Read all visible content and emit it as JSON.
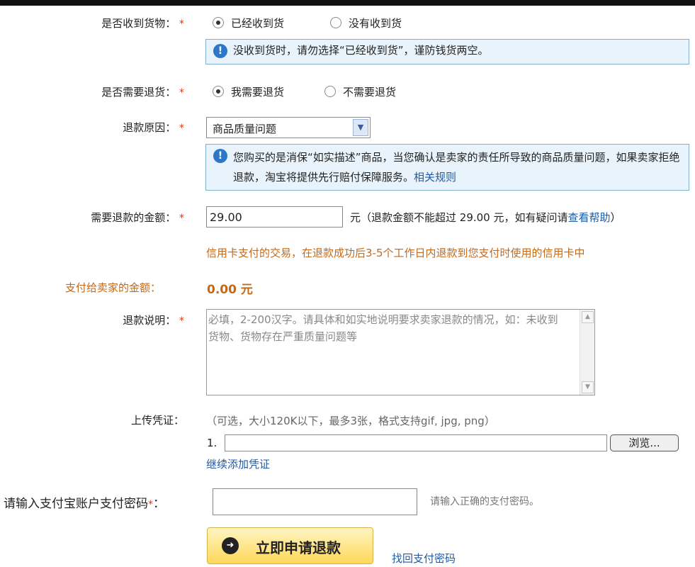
{
  "received": {
    "label": "是否收到货物：",
    "required": "*",
    "options": [
      "已经收到货",
      "没有收到货"
    ],
    "selected": 0,
    "notice": "没收到货时，请勿选择“已经收到货”，谨防钱货两空。"
  },
  "return_goods": {
    "label": "是否需要退货：",
    "required": "*",
    "options": [
      "我需要退货",
      "不需要退货"
    ],
    "selected": 0
  },
  "refund_reason": {
    "label": "退款原因：",
    "required": "*",
    "value": "商品质量问题",
    "notice_text": "您购买的是消保“如实描述”商品，当您确认是卖家的责任所导致的商品质量问题，如果卖家拒绝退款，淘宝将提供先行赔付保障服务。",
    "notice_link": "相关规则"
  },
  "refund_amount": {
    "label": "需要退款的金额：",
    "required": "*",
    "value": "29.00",
    "hint": "元（退款金额不能超过 29.00 元，如有疑问请",
    "hint_link": "查看帮助",
    "hint_end": "）",
    "credit_note": "信用卡支付的交易，在退款成功后3-5个工作日内退款到您支付时使用的信用卡中"
  },
  "pay_seller": {
    "label": "支付给卖家的金额：",
    "value": "0.00 元"
  },
  "refund_desc": {
    "label": "退款说明：",
    "required": "*",
    "placeholder": "必填，2-200汉字。请具体和如实地说明要求卖家退款的情况，如：未收到货物、货物存在严重质量问题等"
  },
  "upload": {
    "label": "上传凭证：",
    "hint": "（可选，大小120K以下，最多3张，格式支持gif, jpg, png）",
    "index": "1.",
    "browse": "浏览...",
    "add_more": "继续添加凭证"
  },
  "password": {
    "label": "请输入支付宝账户支付密码",
    "required": "*",
    "colon": "：",
    "hint": "请输入正确的支付密码。"
  },
  "actions": {
    "apply": "立即申请退款",
    "forgot": "找回支付密码"
  },
  "colors": {
    "notice_bg": "#e8f3fb",
    "notice_border": "#7fb1d2",
    "accent_orange": "#c2691a",
    "link_blue": "#1f5aa8",
    "required_red": "#d43b1f"
  }
}
